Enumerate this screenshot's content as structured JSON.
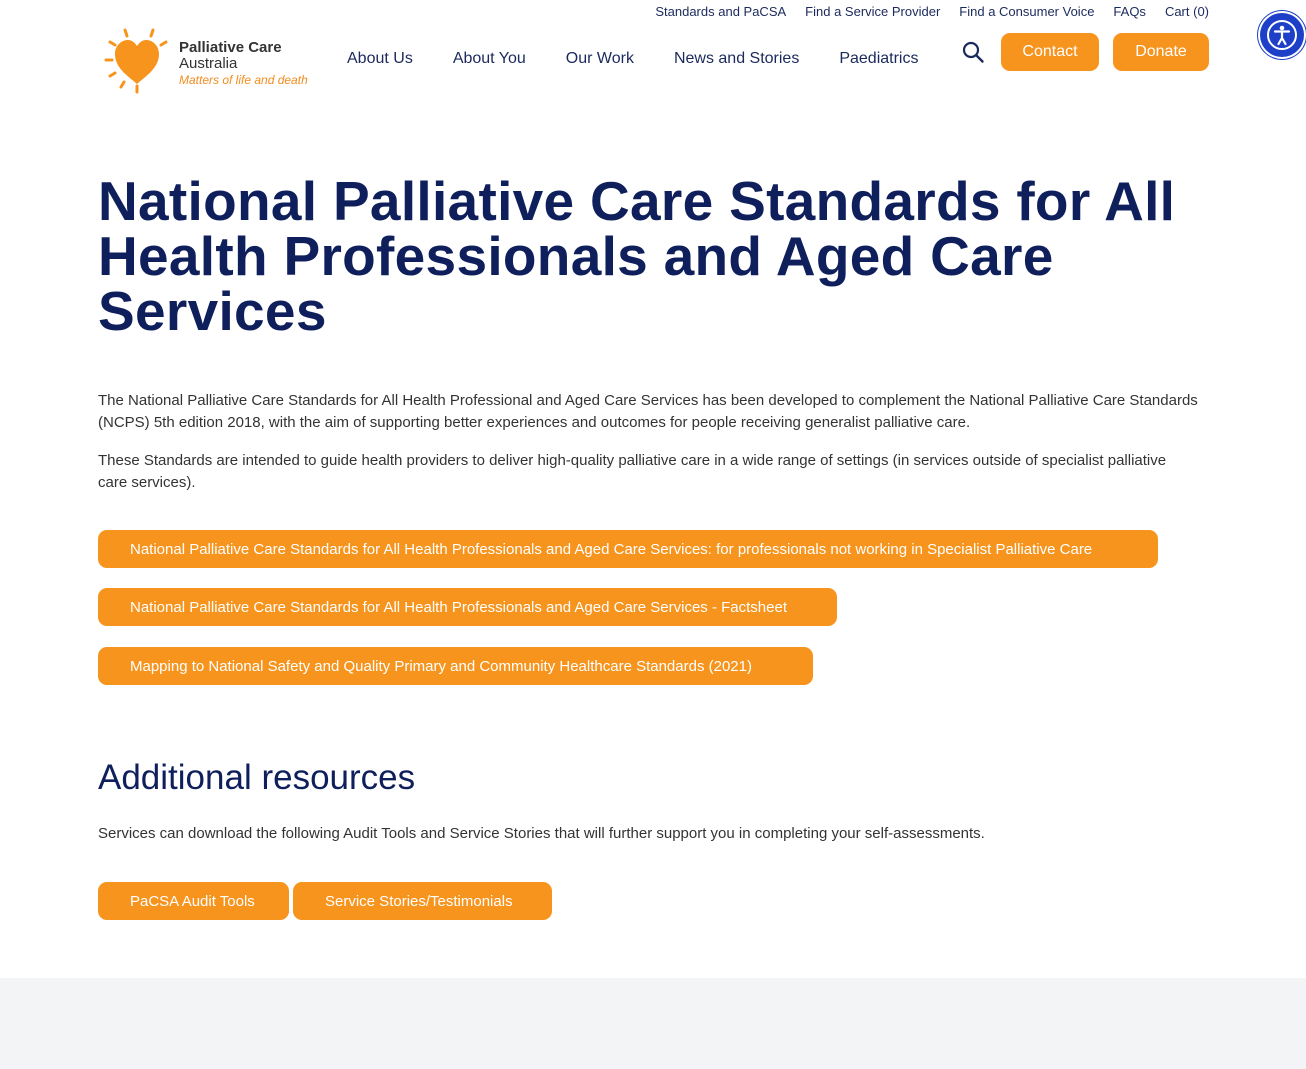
{
  "header": {
    "utility_nav": [
      "Standards and PaCSA",
      "Find a Service Provider",
      "Find a Consumer Voice",
      "FAQs",
      "Cart (0)"
    ],
    "logo": {
      "name": "Palliative Care",
      "sub": "Australia",
      "tagline": "Matters of life and death"
    },
    "main_nav": [
      "About Us",
      "About You",
      "Our Work",
      "News and Stories",
      "Paediatrics"
    ],
    "contact_label": "Contact",
    "donate_label": "Donate"
  },
  "page": {
    "title": "National Palliative Care Standards for All Health Professionals and Aged Care Services",
    "intro_paragraphs": [
      "The National Palliative Care Standards for All Health Professional and Aged Care Services has been developed to complement the National Palliative Care Standards (NCPS) 5th edition 2018, with the aim of supporting better experiences and outcomes for people receiving generalist palliative care.",
      "These Standards are intended to guide health providers to deliver high-quality palliative care in a wide range of settings (in services outside of specialist palliative care services)."
    ],
    "document_buttons": [
      "National Palliative Care Standards for All Health Professionals and Aged Care Services: for professionals not working in Specialist Palliative Care",
      "National Palliative Care Standards for All Health Professionals and Aged Care Services - Factsheet",
      "Mapping to National Safety and Quality Primary and Community Healthcare Standards (2021)"
    ],
    "additional_heading": "Additional resources",
    "additional_text": "Services can download the following Audit Tools and Service Stories that will further support you in completing your self-assessments.",
    "resource_buttons": [
      "PaCSA Audit Tools",
      "Service Stories/Testimonials"
    ]
  },
  "colors": {
    "accent": "#f7941d",
    "navy": "#0f1f5c",
    "a11y": "#1e40c8",
    "footer": "#f3f4f6"
  },
  "icons": {
    "search": "search-icon",
    "accessibility": "accessibility-icon",
    "logo_heart": "heart-sun-icon"
  }
}
